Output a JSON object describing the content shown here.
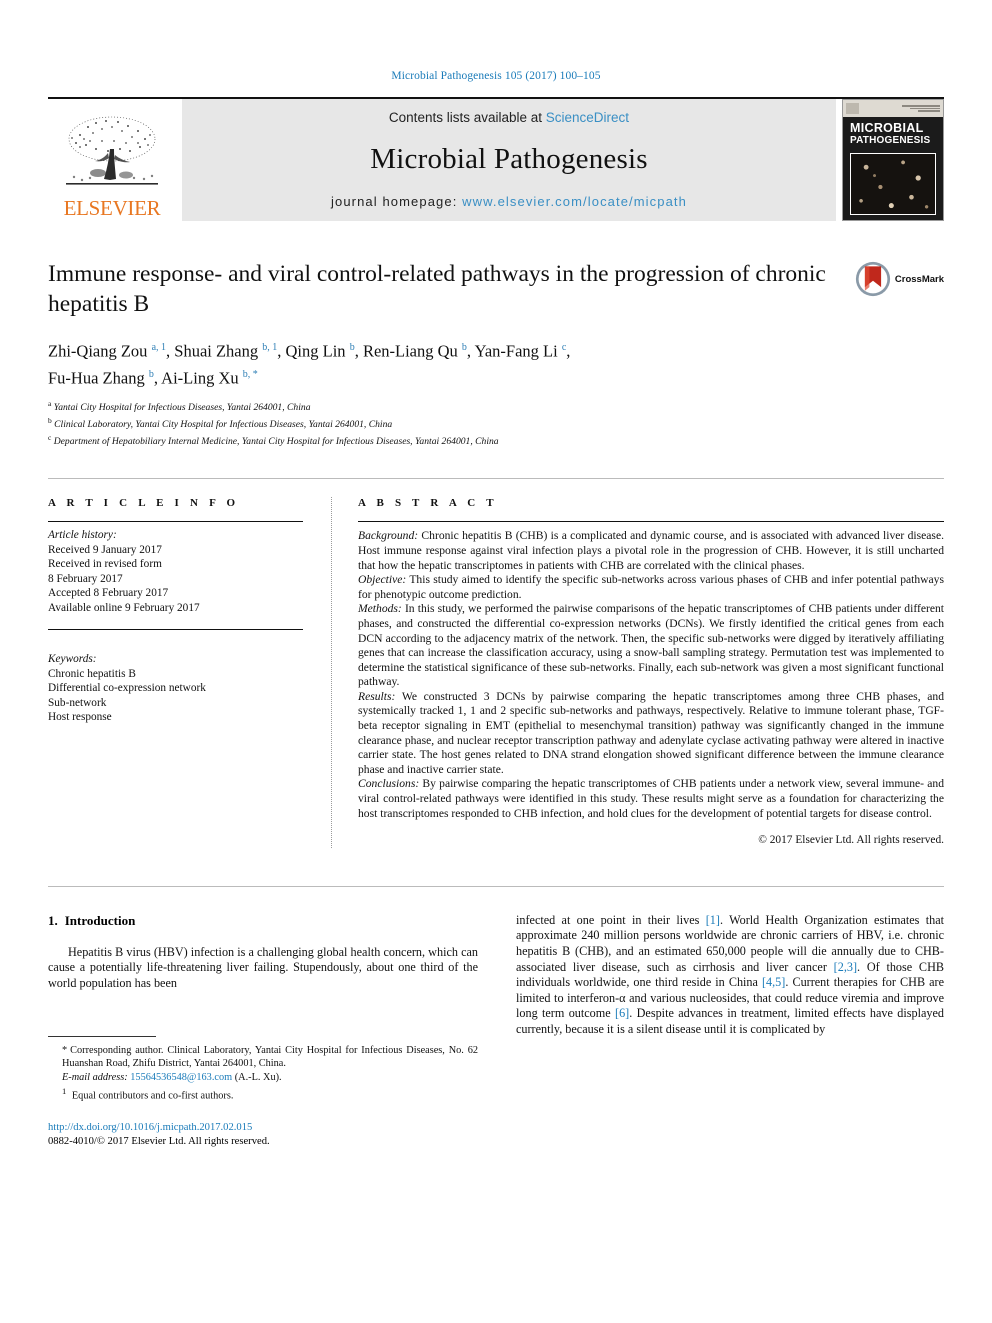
{
  "running_head": "Microbial Pathogenesis 105 (2017) 100–105",
  "masthead": {
    "contents_prefix": "Contents lists available at",
    "sciencedirect": "ScienceDirect",
    "journal_name": "Microbial Pathogenesis",
    "homepage_prefix": "journal homepage:",
    "homepage_url": "www.elsevier.com/locate/micpath",
    "publisher_wordmark": "ELSEVIER",
    "cover_title_line1": "MICROBIAL",
    "cover_title_line2": "PATHOGENESIS"
  },
  "article": {
    "title": "Immune response- and viral control-related pathways in the progression of chronic hepatitis B",
    "crossmark_label": "CrossMark"
  },
  "authors": {
    "line1_parts": [
      {
        "name": "Zhi-Qiang Zou",
        "sup": "a, 1",
        "sep": ", "
      },
      {
        "name": "Shuai Zhang",
        "sup": "b, 1",
        "sep": ", "
      },
      {
        "name": "Qing Lin",
        "sup": "b",
        "sep": ", "
      },
      {
        "name": "Ren-Liang Qu",
        "sup": "b",
        "sep": ", "
      },
      {
        "name": "Yan-Fang Li",
        "sup": "c",
        "sep": ","
      }
    ],
    "line2_parts": [
      {
        "name": "Fu-Hua Zhang",
        "sup": "b",
        "sep": ", "
      },
      {
        "name": "Ai-Ling Xu",
        "sup": "b, *",
        "sep": ""
      }
    ]
  },
  "affiliations": [
    {
      "marker": "a",
      "text": "Yantai City Hospital for Infectious Diseases, Yantai 264001, China"
    },
    {
      "marker": "b",
      "text": "Clinical Laboratory, Yantai City Hospital for Infectious Diseases, Yantai 264001, China"
    },
    {
      "marker": "c",
      "text": "Department of Hepatobiliary Internal Medicine, Yantai City Hospital for Infectious Diseases, Yantai 264001, China"
    }
  ],
  "article_info": {
    "heading": "A R T I C L E   I N F O",
    "history_label": "Article history:",
    "history": [
      "Received 9 January 2017",
      "Received in revised form",
      "8 February 2017",
      "Accepted 8 February 2017",
      "Available online 9 February 2017"
    ],
    "keywords_label": "Keywords:",
    "keywords": [
      "Chronic hepatitis B",
      "Differential co-expression network",
      "Sub-network",
      "Host response"
    ]
  },
  "abstract": {
    "heading": "A B S T R A C T",
    "background_label": "Background:",
    "background_text": " Chronic hepatitis B (CHB) is a complicated and dynamic course, and is associated with advanced liver disease. Host immune response against viral infection plays a pivotal role in the progression of CHB. However, it is still uncharted that how the hepatic transcriptomes in patients with CHB are correlated with the clinical phases.",
    "objective_label": "Objective:",
    "objective_text": " This study aimed to identify the specific sub-networks across various phases of CHB and infer potential pathways for phenotypic outcome prediction.",
    "methods_label": "Methods:",
    "methods_text": " In this study, we performed the pairwise comparisons of the hepatic transcriptomes of CHB patients under different phases, and constructed the differential co-expression networks (DCNs). We firstly identified the critical genes from each DCN according to the adjacency matrix of the network. Then, the specific sub-networks were digged by iteratively affiliating genes that can increase the classification accuracy, using a snow-ball sampling strategy. Permutation test was implemented to determine the statistical significance of these sub-networks. Finally, each sub-network was given a most significant functional pathway.",
    "results_label": "Results:",
    "results_text": " We constructed 3 DCNs by pairwise comparing the hepatic transcriptomes among three CHB phases, and systemically tracked 1, 1 and 2 specific sub-networks and pathways, respectively. Relative to immune tolerant phase, TGF-beta receptor signaling in EMT (epithelial to mesenchymal transition) pathway was significantly changed in the immune clearance phase, and nuclear receptor transcription pathway and adenylate cyclase activating pathway were altered in inactive carrier state. The host genes related to DNA strand elongation showed significant difference between the immune clearance phase and inactive carrier state.",
    "conclusions_label": "Conclusions:",
    "conclusions_text": " By pairwise comparing the hepatic transcriptomes of CHB patients under a network view, several immune- and viral control-related pathways were identified in this study. These results might serve as a foundation for characterizing the host transcriptomes responded to CHB infection, and hold clues for the development of potential targets for disease control.",
    "copyright": "© 2017 Elsevier Ltd. All rights reserved."
  },
  "introduction": {
    "number": "1.",
    "title": "Introduction",
    "left_paragraph": "Hepatitis B virus (HBV) infection is a challenging global health concern, which can cause a potentially life-threatening liver failing. Stupendously, about one third of the world population has been",
    "right_paragraph_segments": [
      {
        "t": "infected at one point in their lives ",
        "k": "plain"
      },
      {
        "t": "[1]",
        "k": "ref"
      },
      {
        "t": ". World Health Organization estimates that approximate 240 million persons worldwide are chronic carriers of HBV, i.e. chronic hepatitis B (CHB), and an estimated 650,000 people will die annually due to CHB-associated liver disease, such as cirrhosis and liver cancer ",
        "k": "plain"
      },
      {
        "t": "[2,3]",
        "k": "ref"
      },
      {
        "t": ". Of those CHB individuals worldwide, one third reside in China ",
        "k": "plain"
      },
      {
        "t": "[4,5]",
        "k": "ref"
      },
      {
        "t": ". Current therapies for CHB are limited to interferon-α and various nucleosides, that could reduce viremia and improve long term outcome ",
        "k": "plain"
      },
      {
        "t": "[6]",
        "k": "ref"
      },
      {
        "t": ". Despite advances in treatment, limited effects have displayed currently, because it is a silent disease until it is complicated by",
        "k": "plain"
      }
    ]
  },
  "footnotes": {
    "corresponding_marker": "*",
    "corresponding_text": "Corresponding author. Clinical Laboratory, Yantai City Hospital for Infectious Diseases, No. 62 Huanshan Road, Zhifu District, Yantai 264001, China.",
    "email_label": "E-mail address:",
    "email_address": "15564536548@163.com",
    "email_suffix": "(A.-L. Xu).",
    "equal_marker": "1",
    "equal_text": "Equal contributors and co-first authors.",
    "doi_url": "http://dx.doi.org/10.1016/j.micpath.2017.02.015",
    "issn_line": "0882-4010/© 2017 Elsevier Ltd. All rights reserved."
  }
}
